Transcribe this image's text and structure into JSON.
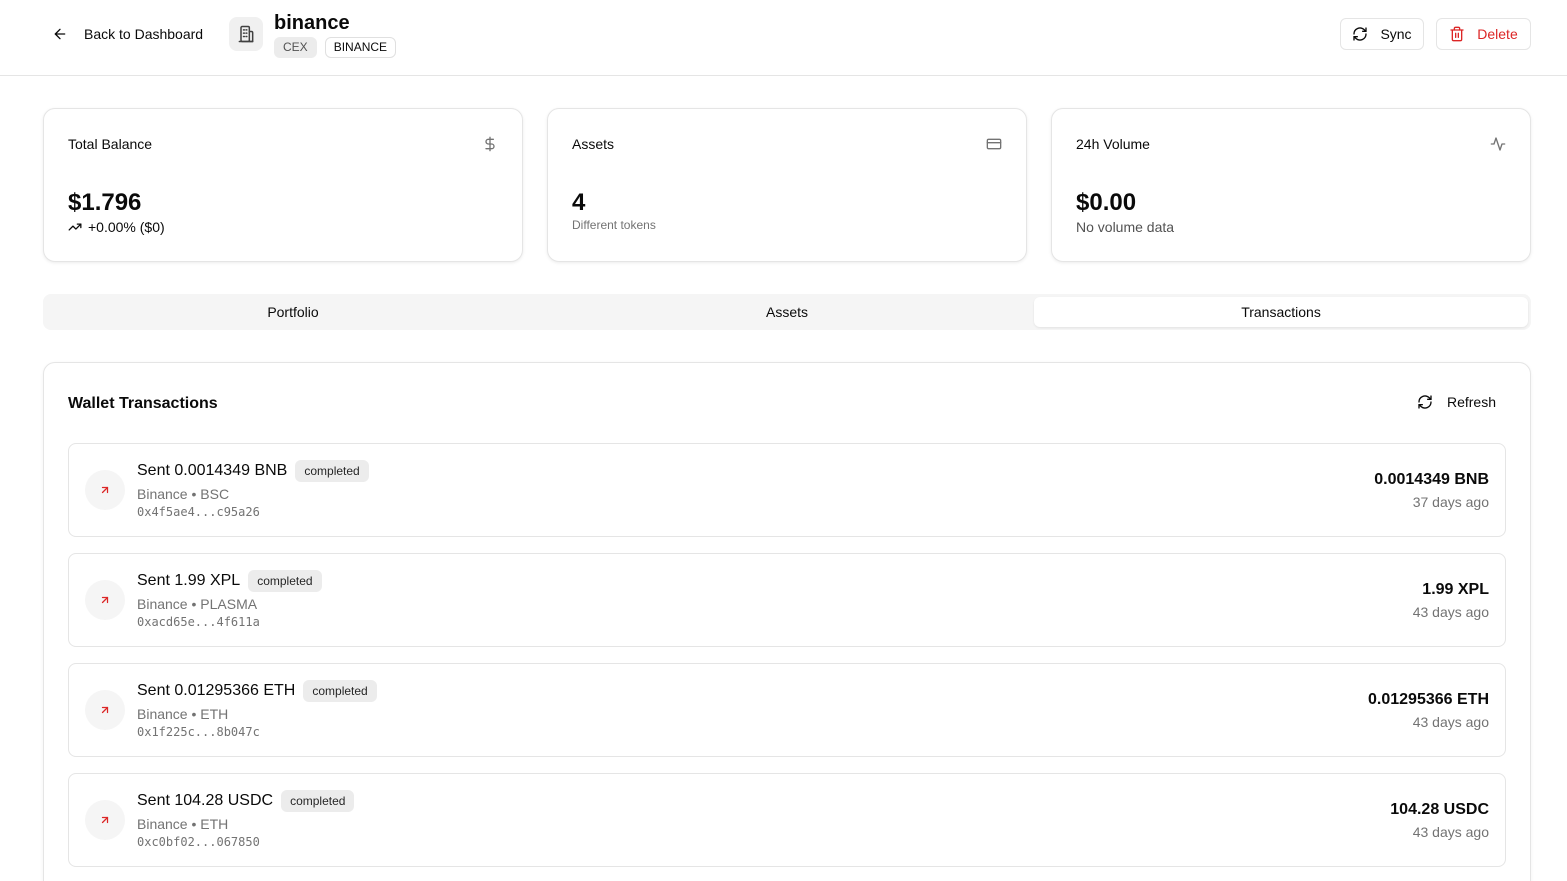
{
  "header": {
    "back_label": "Back to Dashboard",
    "wallet_name": "binance",
    "badges": [
      "CEX",
      "BINANCE"
    ],
    "sync_label": "Sync",
    "delete_label": "Delete"
  },
  "stats": [
    {
      "label": "Total Balance",
      "icon": "dollar-icon",
      "value": "$1.796",
      "sub": "+0.00% ($0)",
      "sub_icon": "trending-up-icon"
    },
    {
      "label": "Assets",
      "icon": "credit-card-icon",
      "value": "4",
      "sub": "Different tokens"
    },
    {
      "label": "24h Volume",
      "icon": "activity-icon",
      "value": "$0.00",
      "sub": "No volume data"
    }
  ],
  "tabs": [
    {
      "label": "Portfolio",
      "active": false
    },
    {
      "label": "Assets",
      "active": false
    },
    {
      "label": "Transactions",
      "active": true
    }
  ],
  "transactions_panel": {
    "title": "Wallet Transactions",
    "refresh_label": "Refresh",
    "items": [
      {
        "description": "Sent 0.0014349 BNB",
        "status": "completed",
        "network": "Binance • BSC",
        "hash": "0x4f5ae4...c95a26",
        "amount": "0.0014349 BNB",
        "time": "37 days ago"
      },
      {
        "description": "Sent 1.99 XPL",
        "status": "completed",
        "network": "Binance • PLASMA",
        "hash": "0xacd65e...4f611a",
        "amount": "1.99 XPL",
        "time": "43 days ago"
      },
      {
        "description": "Sent 0.01295366 ETH",
        "status": "completed",
        "network": "Binance • ETH",
        "hash": "0x1f225c...8b047c",
        "amount": "0.01295366 ETH",
        "time": "43 days ago"
      },
      {
        "description": "Sent 104.28 USDC",
        "status": "completed",
        "network": "Binance • ETH",
        "hash": "0xc0bf02...067850",
        "amount": "104.28 USDC",
        "time": "43 days ago"
      }
    ]
  },
  "colors": {
    "delete_red": "#dc2626",
    "sent_arrow_red": "#dc2626",
    "border": "#e5e5e5",
    "muted_text": "#737373"
  }
}
